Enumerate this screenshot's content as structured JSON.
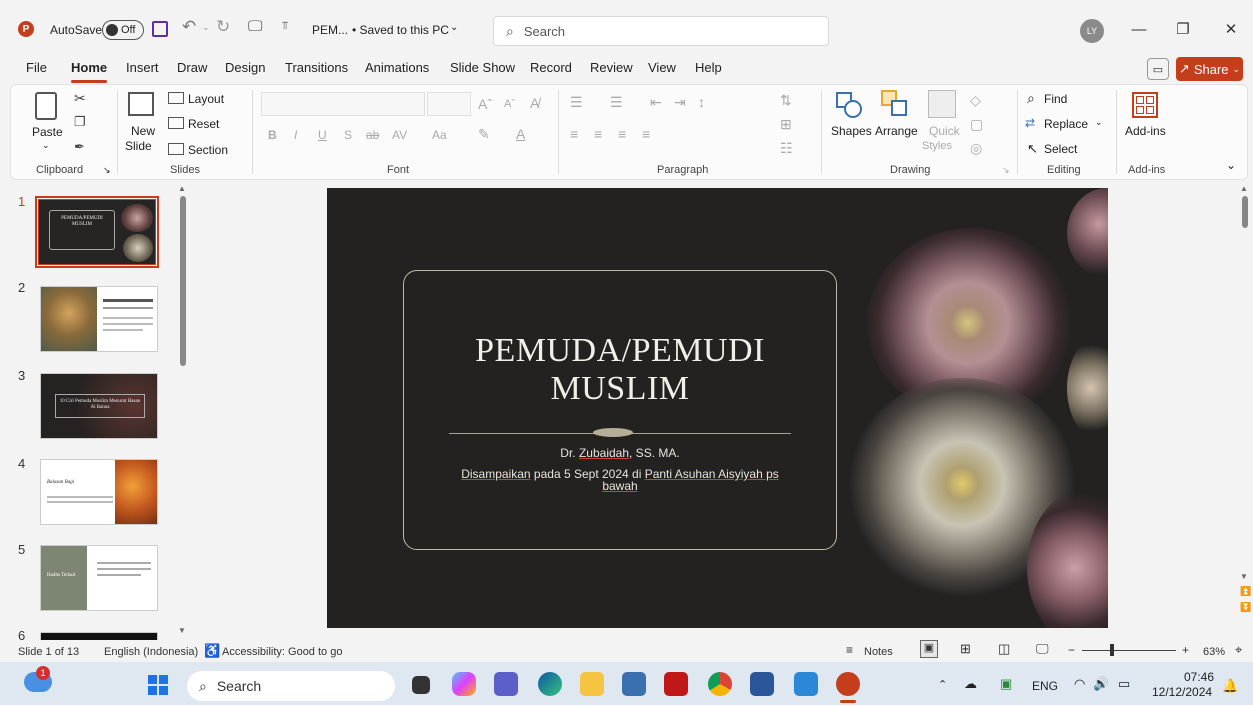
{
  "titlebar": {
    "autosave_label": "AutoSave",
    "autosave_state": "Off",
    "doc_title": "PEM...",
    "save_status": "• Saved to this PC",
    "search_placeholder": "Search",
    "user_initials": "LY"
  },
  "menu": {
    "tabs": [
      "File",
      "Home",
      "Insert",
      "Draw",
      "Design",
      "Transitions",
      "Animations",
      "Slide Show",
      "Record",
      "Review",
      "View",
      "Help"
    ],
    "active": "Home",
    "share_label": "Share"
  },
  "ribbon": {
    "clipboard": {
      "paste": "Paste",
      "label": "Clipboard"
    },
    "slides": {
      "new_slide_1": "New",
      "new_slide_2": "Slide",
      "layout": "Layout",
      "reset": "Reset",
      "section": "Section",
      "label": "Slides"
    },
    "font": {
      "label": "Font",
      "grow": "Aˆ",
      "shrink": "Aˇ",
      "bold": "B",
      "italic": "I",
      "underline": "U",
      "strike": "S",
      "strike2": "ab",
      "spacing": "AV",
      "case": "Aa"
    },
    "paragraph": {
      "label": "Paragraph"
    },
    "drawing": {
      "shapes": "Shapes",
      "arrange": "Arrange",
      "quick_1": "Quick",
      "quick_2": "Styles",
      "label": "Drawing"
    },
    "editing": {
      "find": "Find",
      "replace": "Replace",
      "select": "Select",
      "label": "Editing"
    },
    "addins": {
      "button": "Add-ins",
      "label": "Add-ins"
    }
  },
  "thumbnails": [
    {
      "num": "1",
      "title": "PEMUDA/PEMUDI MUSLIM",
      "selected": true
    },
    {
      "num": "2",
      "title": "",
      "selected": false
    },
    {
      "num": "3",
      "title": "10 Ciri Pemuda Muslim Menurut Hasan Al Banna",
      "selected": false
    },
    {
      "num": "4",
      "title": "Balasan Bagi",
      "selected": false
    },
    {
      "num": "5",
      "title": "Hadits Terkait",
      "selected": false
    },
    {
      "num": "6",
      "title": "",
      "selected": false
    }
  ],
  "slide": {
    "title_line1": "PEMUDA/PEMUDI",
    "title_line2": "MUSLIM",
    "author_prefix": "Dr. ",
    "author_name": "Zubaidah",
    "author_suffix": ", SS. MA.",
    "line2_a": "Disampaikan",
    "line2_b": " pada 5 Sept 2024 di ",
    "line2_c": "Panti Asuhan Aisyiyah ps",
    "line2_d": "bawah"
  },
  "statusbar": {
    "slide_pos": "Slide 1 of 13",
    "language": "English (Indonesia)",
    "accessibility": "Accessibility: Good to go",
    "notes": "Notes",
    "zoom": "63%"
  },
  "taskbar": {
    "search": "Search",
    "lang": "ENG",
    "time": "07:46",
    "date": "12/12/2024",
    "badge": "1"
  },
  "colors": {
    "accent": "#c43e1c",
    "slide_bg": "#232221"
  }
}
